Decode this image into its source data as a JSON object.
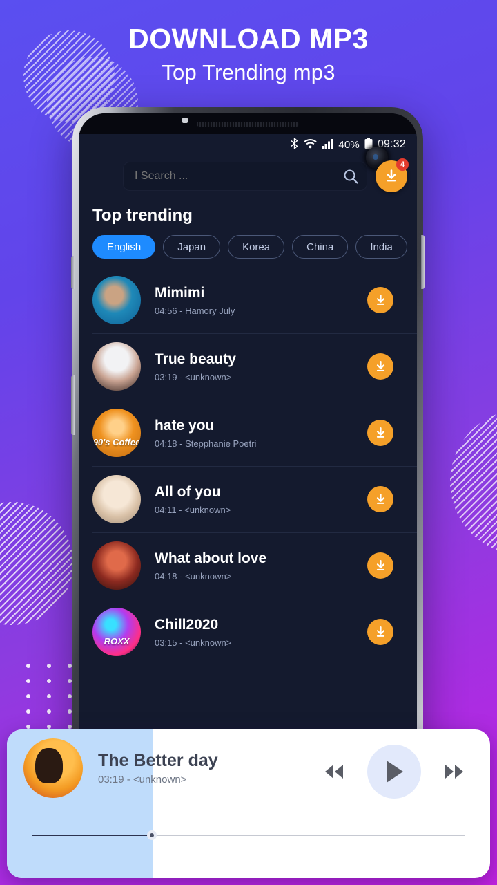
{
  "promo": {
    "title": "DOWNLOAD MP3",
    "subtitle": "Top Trending mp3"
  },
  "theme": {
    "accent_orange": "#f5a029",
    "accent_blue": "#1e8bff",
    "badge_red": "#e23b2e",
    "screen_bg": "#141a2e",
    "player_panel": "#bfdcfb"
  },
  "statusbar": {
    "bluetooth_icon": "bluetooth-icon",
    "wifi_icon": "wifi-icon",
    "signal_icon": "signal-icon",
    "battery_percent": "40%",
    "battery_icon": "battery-icon",
    "clock": "09:32"
  },
  "search": {
    "placeholder": "I Search ...",
    "value": "",
    "icon": "search-icon"
  },
  "download_button": {
    "icon": "download-icon",
    "badge": "4"
  },
  "section": {
    "title": "Top trending"
  },
  "chips": [
    {
      "label": "English",
      "active": true
    },
    {
      "label": "Japan",
      "active": false
    },
    {
      "label": "Korea",
      "active": false
    },
    {
      "label": "China",
      "active": false
    },
    {
      "label": "India",
      "active": false
    }
  ],
  "tracks": [
    {
      "title": "Mimimi",
      "sub": "04:56 - Hamory July",
      "duration": "04:56",
      "artist": "Hamory July",
      "art": "t1",
      "art_text": ""
    },
    {
      "title": "True beauty",
      "sub": "03:19 - <unknown>",
      "duration": "03:19",
      "artist": "<unknown>",
      "art": "t2",
      "art_text": ""
    },
    {
      "title": "hate you",
      "sub": "04:18 - Stepphanie Poetri",
      "duration": "04:18",
      "artist": "Stepphanie Poetri",
      "art": "t3",
      "art_text": "90's Coffee"
    },
    {
      "title": "All of you",
      "sub": "04:11 - <unknown>",
      "duration": "04:11",
      "artist": "<unknown>",
      "art": "t4",
      "art_text": ""
    },
    {
      "title": "What about love",
      "sub": "04:18 - <unknown>",
      "duration": "04:18",
      "artist": "<unknown>",
      "art": "t5",
      "art_text": ""
    },
    {
      "title": "Chill2020",
      "sub": "03:15 - <unknown>",
      "duration": "03:15",
      "artist": "<unknown>",
      "art": "t6",
      "art_text": "ROXX"
    }
  ],
  "player": {
    "title": "The Better day",
    "sub": "03:19 - <unknown>",
    "duration": "03:19",
    "artist": "<unknown>",
    "progress_percent": 28,
    "rewind_icon": "rewind-icon",
    "play_icon": "play-icon",
    "forward_icon": "fast-forward-icon"
  }
}
